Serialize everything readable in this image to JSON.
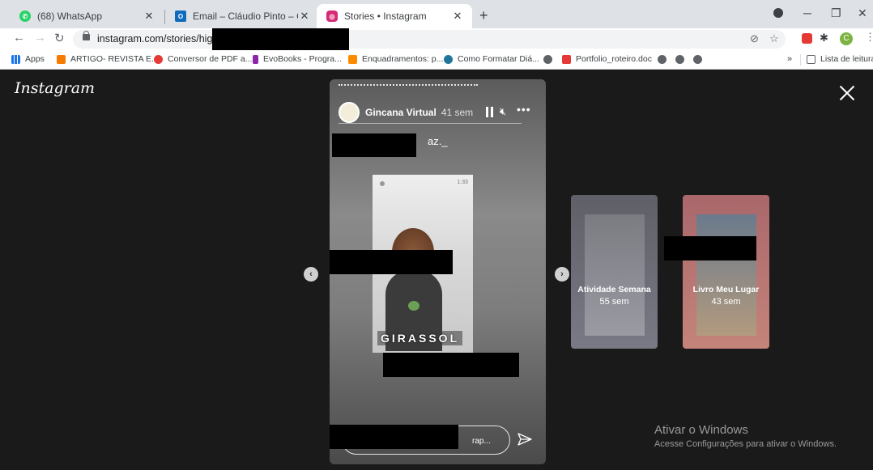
{
  "browser": {
    "tabs": [
      {
        "title": "(68) WhatsApp",
        "icon": "whatsapp-icon",
        "color": "#25d366"
      },
      {
        "title": "Email – Cláudio Pinto – Outlook",
        "icon": "outlook-icon",
        "color": "#0f6cbd"
      },
      {
        "title": "Stories • Instagram",
        "icon": "instagram-icon",
        "color": "#d62976"
      }
    ],
    "url": "instagram.com/stories/highlig",
    "avatar_letter": "C",
    "bookmarks": {
      "apps": "Apps",
      "items": [
        {
          "label": "ARTIGO- REVISTA E...",
          "color": "#f57c00"
        },
        {
          "label": "Conversor de PDF a...",
          "color": "#e53935"
        },
        {
          "label": "EvoBooks - Progra...",
          "color": "#8e24aa"
        },
        {
          "label": "Enquadramentos: p...",
          "color": "#fb8c00"
        },
        {
          "label": "Como Formatar Diá...",
          "color": "#21759b"
        },
        {
          "label": "Portfolio_roteiro.doc",
          "color": "#e53935"
        }
      ],
      "overflow": "»",
      "reading_list": "Lista de leitura"
    }
  },
  "instagram": {
    "logo": "Instagram",
    "story": {
      "username": "Gincana Virtual",
      "time": "41 sem",
      "mention": "az._",
      "photo_time": "1:33",
      "sticker_text": "GIRASSOL",
      "reply_placeholder": "rap..."
    },
    "previews": [
      {
        "title": "Atividade Semana",
        "time": "55 sem"
      },
      {
        "title": "Livro Meu Lugar",
        "time": "43 sem"
      }
    ]
  },
  "windows_watermark": {
    "title": "Ativar o Windows",
    "subtitle": "Acesse Configurações para ativar o Windows."
  }
}
